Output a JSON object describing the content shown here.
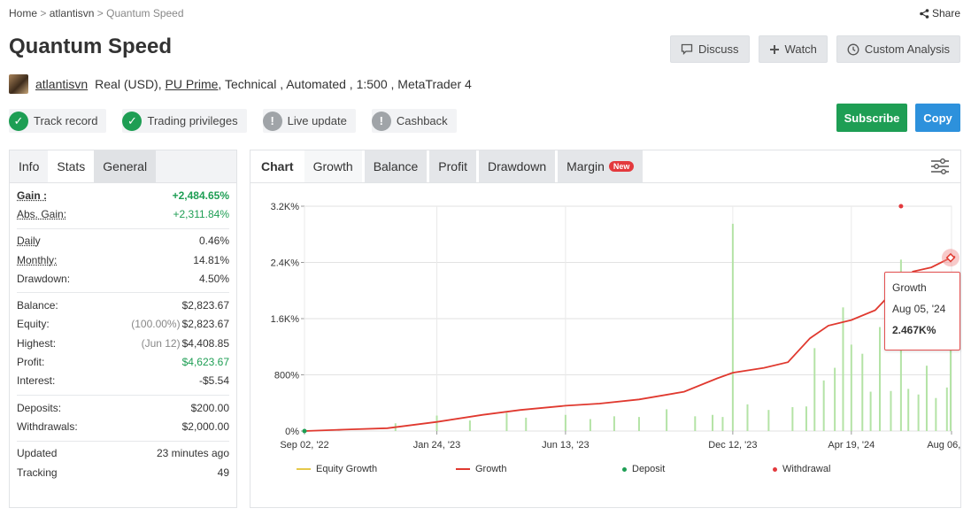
{
  "breadcrumb": {
    "home": "Home",
    "sep": ">",
    "user": "atlantisvn",
    "current": "Quantum Speed"
  },
  "share_label": "Share",
  "title": "Quantum Speed",
  "actions": {
    "discuss": "Discuss",
    "watch": "Watch",
    "custom": "Custom Analysis"
  },
  "meta": {
    "username": "atlantisvn",
    "account": "Real (USD),",
    "broker": "PU Prime",
    "details": ", Technical , Automated , 1:500 , MetaTrader 4"
  },
  "badges": [
    {
      "label": "Track record",
      "status": "verified",
      "icon": "check-icon"
    },
    {
      "label": "Trading privileges",
      "status": "verified",
      "icon": "check-icon"
    },
    {
      "label": "Live update",
      "status": "unverified",
      "icon": "exclamation-icon"
    },
    {
      "label": "Cashback",
      "status": "unverified",
      "icon": "exclamation-icon"
    }
  ],
  "subscribe_label": "Subscribe",
  "copy_label": "Copy",
  "left_tabs": [
    "Info",
    "Stats",
    "General"
  ],
  "stats": {
    "gain": {
      "label": "Gain :",
      "value": "+2,484.65%"
    },
    "abs_gain": {
      "label": "Abs. Gain:",
      "value": "+2,311.84%"
    },
    "daily": {
      "label": "Daily",
      "value": "0.46%"
    },
    "monthly": {
      "label": "Monthly:",
      "value": "14.81%"
    },
    "drawdown": {
      "label": "Drawdown:",
      "value": "4.50%"
    },
    "balance": {
      "label": "Balance:",
      "value": "$2,823.67"
    },
    "equity": {
      "label": "Equity:",
      "note": "(100.00%)",
      "value": "$2,823.67"
    },
    "highest": {
      "label": "Highest:",
      "note": "(Jun 12)",
      "value": "$4,408.85"
    },
    "profit": {
      "label": "Profit:",
      "value": "$4,623.67"
    },
    "interest": {
      "label": "Interest:",
      "value": "-$5.54"
    },
    "deposits": {
      "label": "Deposits:",
      "value": "$200.00"
    },
    "withdrawals": {
      "label": "Withdrawals:",
      "value": "$2,000.00"
    },
    "updated": {
      "label": "Updated",
      "value": "23 minutes ago"
    },
    "tracking": {
      "label": "Tracking",
      "value": "49"
    }
  },
  "chart_tabs": {
    "chart": "Chart",
    "growth": "Growth",
    "balance": "Balance",
    "profit": "Profit",
    "drawdown": "Drawdown",
    "margin": "Margin",
    "margin_badge": "New"
  },
  "colors": {
    "growth": "#e0392f",
    "equity": "#e6c84a",
    "bars": "#b4e3a6",
    "deposit": "#1e9e54",
    "withdrawal": "#e3393d",
    "subscribe": "#1e9e54",
    "copy": "#2d91dc"
  },
  "tooltip": {
    "title": "Growth",
    "date": "Aug 05, '24",
    "value": "2.467K%"
  },
  "legend": {
    "equity": "Equity Growth",
    "growth": "Growth",
    "deposit": "Deposit",
    "withdrawal": "Withdrawal"
  },
  "chart_data": {
    "type": "line",
    "title": "",
    "xlabel": "",
    "ylabel": "",
    "ylim": [
      0,
      3200
    ],
    "y_ticks": [
      "0%",
      "800%",
      "1.6K%",
      "2.4K%",
      "3.2K%"
    ],
    "y_tick_values": [
      0,
      800,
      1600,
      2400,
      3200
    ],
    "x_ticks": [
      "Sep 02, '22",
      "Jan 24, '23",
      "Jun 13, '23",
      "Dec 12, '23",
      "Apr 19, '24",
      "Aug 06, '24"
    ],
    "x_tick_dates": [
      "2022-09-02",
      "2023-01-24",
      "2023-06-13",
      "2023-12-12",
      "2024-04-19",
      "2024-08-06"
    ],
    "x_range": [
      "2022-09-02",
      "2024-08-06"
    ],
    "grid": true,
    "legend_position": "bottom",
    "series": [
      {
        "name": "Growth",
        "x": [
          "2022-09-02",
          "2022-10-15",
          "2022-12-01",
          "2023-01-24",
          "2023-03-15",
          "2023-04-25",
          "2023-06-13",
          "2023-07-20",
          "2023-09-01",
          "2023-10-20",
          "2023-11-25",
          "2023-12-12",
          "2024-01-15",
          "2024-02-10",
          "2024-03-05",
          "2024-03-25",
          "2024-04-19",
          "2024-05-15",
          "2024-06-10",
          "2024-06-25",
          "2024-07-15",
          "2024-08-05",
          "2024-08-10"
        ],
        "values": [
          0,
          20,
          40,
          130,
          230,
          300,
          360,
          390,
          450,
          560,
          750,
          830,
          900,
          980,
          1320,
          1500,
          1580,
          1720,
          2080,
          2270,
          2330,
          2467,
          2485
        ]
      }
    ],
    "deposits": [
      {
        "x": "2022-09-02",
        "value": 0
      }
    ],
    "withdrawals": [
      {
        "x": "2024-06-12",
        "value": 3200
      }
    ],
    "bars": {
      "name": "Daily growth",
      "x": [
        "2022-12-10",
        "2023-01-24",
        "2023-03-01",
        "2023-04-10",
        "2023-05-01",
        "2023-06-13",
        "2023-07-10",
        "2023-08-05",
        "2023-09-01",
        "2023-10-01",
        "2023-11-01",
        "2023-11-20",
        "2023-12-01",
        "2023-12-12",
        "2023-12-28",
        "2024-01-20",
        "2024-02-15",
        "2024-03-01",
        "2024-03-10",
        "2024-03-20",
        "2024-04-01",
        "2024-04-10",
        "2024-04-19",
        "2024-05-01",
        "2024-05-10",
        "2024-05-20",
        "2024-06-01",
        "2024-06-12",
        "2024-06-20",
        "2024-07-01",
        "2024-07-10",
        "2024-07-20",
        "2024-08-01",
        "2024-08-05"
      ],
      "values": [
        110,
        220,
        150,
        260,
        190,
        230,
        170,
        210,
        200,
        310,
        210,
        230,
        200,
        2950,
        380,
        300,
        340,
        350,
        1180,
        720,
        900,
        1760,
        1230,
        1100,
        560,
        1480,
        570,
        2440,
        600,
        520,
        930,
        470,
        620,
        1710
      ]
    }
  }
}
